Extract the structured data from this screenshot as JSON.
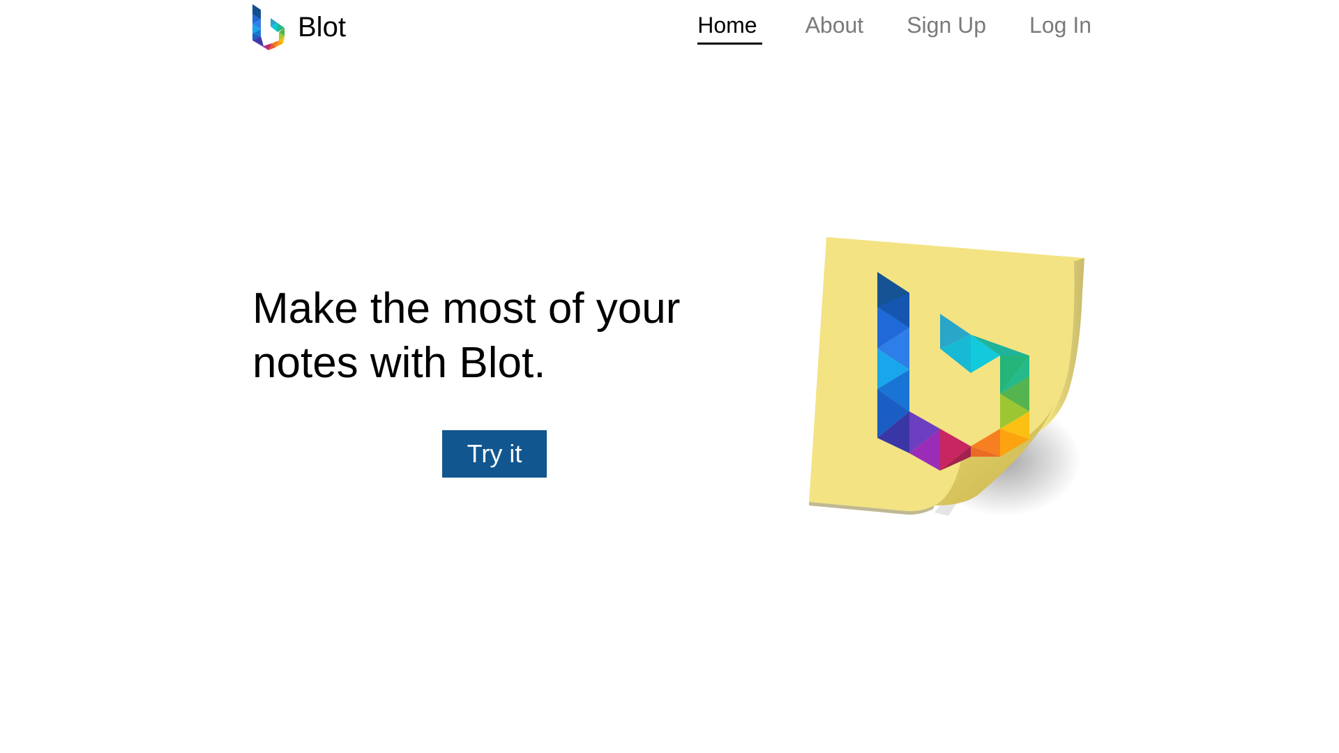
{
  "brand": {
    "name": "Blot",
    "logo_icon": "blot-b-logo-icon"
  },
  "nav": {
    "items": [
      {
        "label": "Home",
        "active": true
      },
      {
        "label": "About",
        "active": false
      },
      {
        "label": "Sign Up",
        "active": false
      },
      {
        "label": "Log In",
        "active": false
      }
    ]
  },
  "hero": {
    "heading_line1": "Make the most of your",
    "heading_line2": "notes with Blot.",
    "cta_label": "Try it",
    "illustration": "sticky-note-with-blot-logo"
  },
  "colors": {
    "cta_background": "#11568f",
    "nav_inactive": "#7a7a7a",
    "note_yellow": "#f3e382"
  }
}
